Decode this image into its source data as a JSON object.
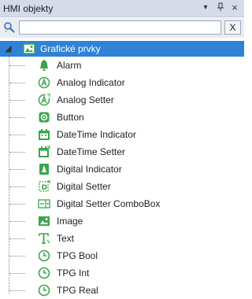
{
  "panel": {
    "title": "HMI objekty",
    "controls": {
      "dropdown": "▾",
      "pin": "ᛒ",
      "close": "×"
    }
  },
  "toolbar": {
    "search_value": "",
    "clear_label": "X"
  },
  "tree": {
    "root": {
      "label": "Grafické prvky",
      "expander": "◢",
      "icon": "image-icon"
    },
    "items": [
      {
        "label": "Alarm",
        "icon": "bell-icon"
      },
      {
        "label": "Analog Indicator",
        "icon": "analog-indicator-icon"
      },
      {
        "label": "Analog Setter",
        "icon": "analog-setter-icon"
      },
      {
        "label": "Button",
        "icon": "button-icon"
      },
      {
        "label": "DateTime Indicator",
        "icon": "calendar-icon"
      },
      {
        "label": "DateTime Setter",
        "icon": "calendar-setter-icon"
      },
      {
        "label": "Digital Indicator",
        "icon": "digital-indicator-icon"
      },
      {
        "label": "Digital Setter",
        "icon": "digital-setter-icon"
      },
      {
        "label": "Digital Setter ComboBox",
        "icon": "combobox-icon"
      },
      {
        "label": "Image",
        "icon": "image-icon"
      },
      {
        "label": "Text",
        "icon": "text-icon"
      },
      {
        "label": "TPG Bool",
        "icon": "clock-icon"
      },
      {
        "label": "TPG Int",
        "icon": "clock-icon"
      },
      {
        "label": "TPG Real",
        "icon": "clock-icon"
      }
    ]
  },
  "colors": {
    "accent": "#2f82d6",
    "icon_green": "#3aa64b",
    "titlebar": "#d6dbe9"
  }
}
